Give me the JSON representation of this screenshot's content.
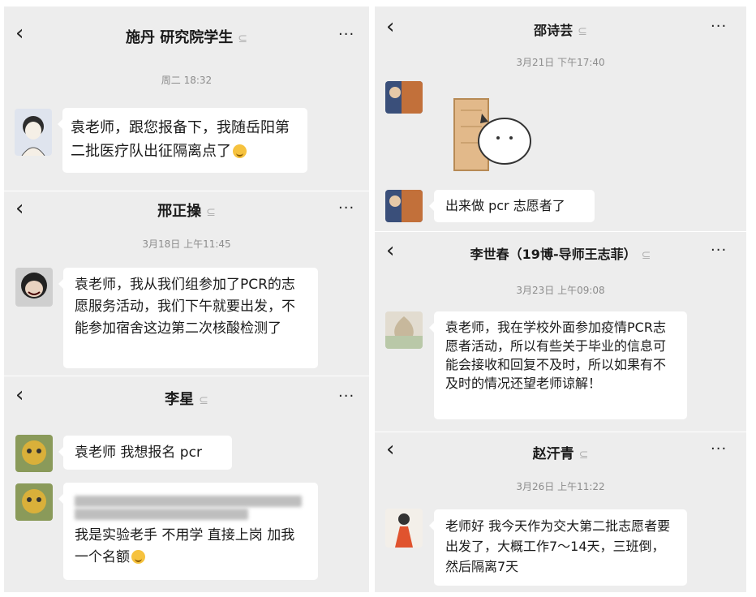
{
  "icons": {
    "back": "‹",
    "more": "···",
    "ear": "ear-icon"
  },
  "chats": [
    {
      "title": "施丹 研究院学生",
      "time": "周二 18:32",
      "message": "袁老师，跟您报备下，我随岳阳第二批医疗队出征隔离点了"
    },
    {
      "title": "邢正操",
      "time": "3月18日 上午11:45",
      "message": "袁老师，我从我们组参加了PCR的志愿服务活动，我们下午就要出发，不能参加宿舍这边第二次核酸检测了"
    },
    {
      "title": "李星",
      "message1": "袁老师 我想报名 pcr",
      "message2": "我是实验老手 不用学 直接上岗 加我一个名额"
    },
    {
      "title": "邵诗芸",
      "time": "3月21日 下午17:40",
      "message": "出来做 pcr 志愿者了"
    },
    {
      "title": "李世春（19博-导师王志菲）",
      "time": "3月23日 上午09:08",
      "message": "袁老师，我在学校外面参加疫情PCR志愿者活动，所以有些关于毕业的信息可能会接收和回复不及时，所以如果有不及时的情况还望老师谅解！"
    },
    {
      "title": "赵汗青",
      "time": "3月26日 上午11:22",
      "message": "老师好 我今天作为交大第二批志愿者要出发了，大概工作7～14天，三班倒，然后隔离7天"
    }
  ]
}
